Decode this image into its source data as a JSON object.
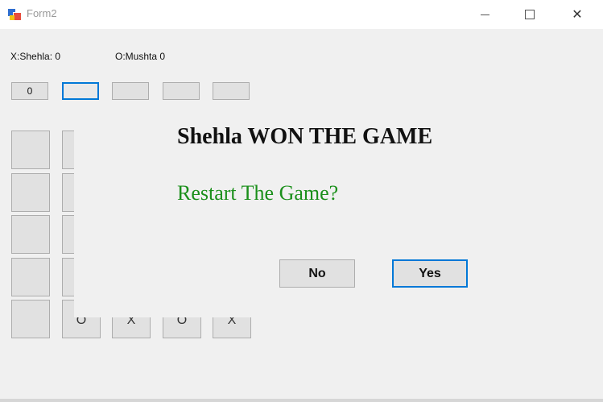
{
  "window": {
    "title": "Form2",
    "controls": [
      "minimize-icon",
      "maximize-icon",
      "close-icon"
    ]
  },
  "scoreboard": {
    "x_label": "X:Shehla: 0",
    "o_label": "O:Mushta",
    "o_score": "0"
  },
  "top_row": {
    "first_button": "0"
  },
  "board": {
    "bottom_row": [
      "O",
      "X",
      "O",
      "X"
    ]
  },
  "dialog": {
    "message": "Shehla WON THE GAME",
    "question": "Restart The Game?",
    "no_label": "No",
    "yes_label": "Yes",
    "question_color": "#1a8f1a",
    "focus_color": "#0078d7"
  }
}
